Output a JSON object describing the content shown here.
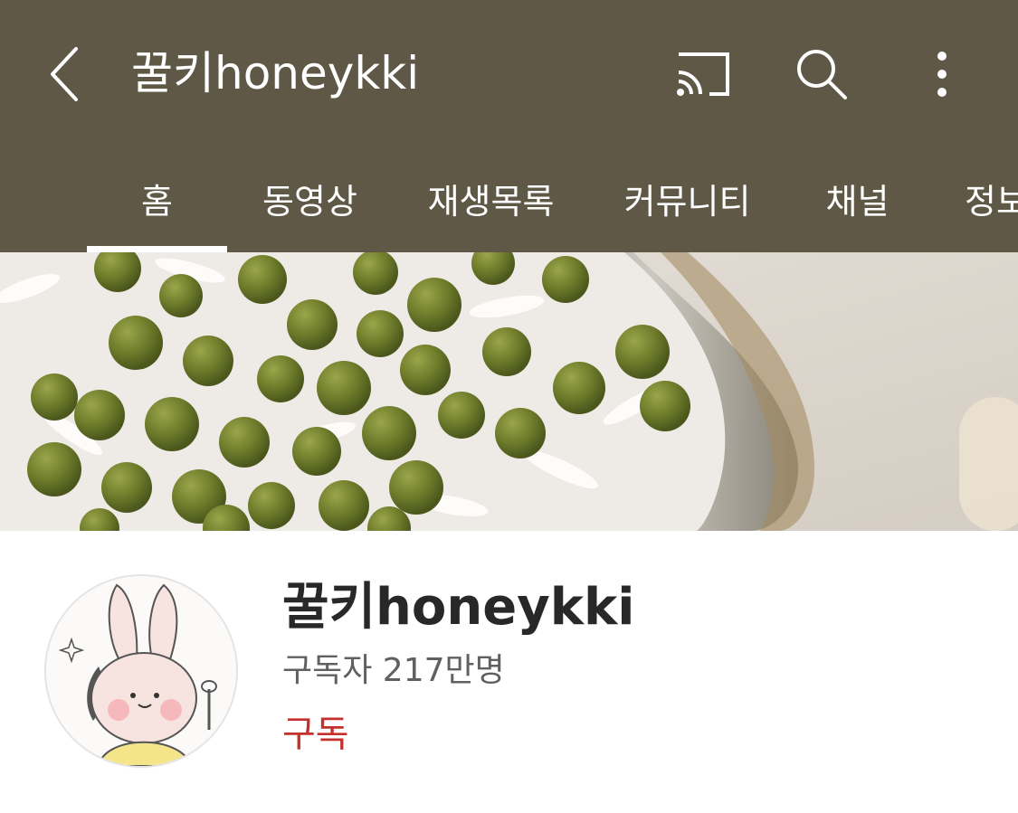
{
  "appbar": {
    "title": "꿀키honeykki",
    "background_color": "#5f5846",
    "back_icon": "chevron-left-icon",
    "cast_icon": "cast-icon",
    "search_icon": "search-icon",
    "more_icon": "more-vert-icon"
  },
  "tabs": [
    {
      "label": "홈",
      "selected": true
    },
    {
      "label": "동영상",
      "selected": false
    },
    {
      "label": "재생목록",
      "selected": false
    },
    {
      "label": "커뮤니티",
      "selected": false
    },
    {
      "label": "채널",
      "selected": false
    },
    {
      "label": "정보",
      "selected": false
    }
  ],
  "channel": {
    "name": "꿀키honeykki",
    "subscribers": "구독자 217만명",
    "subscribe_label": "구독",
    "subscribe_color": "#c4302b"
  }
}
